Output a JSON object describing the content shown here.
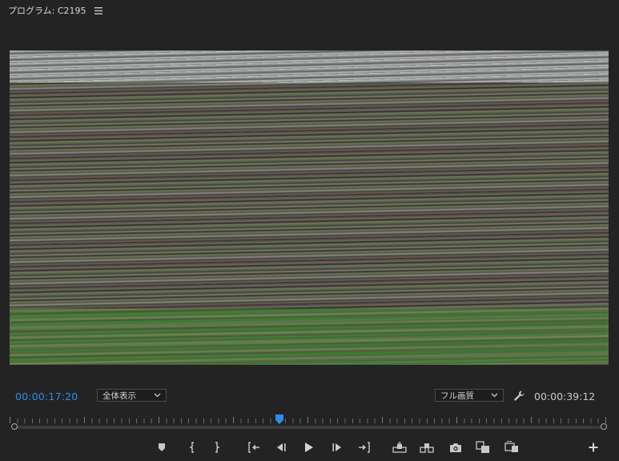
{
  "panel": {
    "title": "プログラム: C2195",
    "menu_icon": "hamburger-menu-icon"
  },
  "timecode": {
    "current": "00:00:17:20",
    "duration": "00:00:39:12"
  },
  "zoom_select": {
    "value": "全体表示"
  },
  "quality_select": {
    "value": "フル画質"
  },
  "timeline": {
    "playhead_fraction": 0.45
  },
  "colors": {
    "accent": "#2d8ceb",
    "panel_bg": "#232323"
  },
  "transport_buttons": [
    {
      "name": "add-marker-button",
      "icon": "marker-icon"
    },
    {
      "name": "mark-in-button",
      "icon": "mark-in-icon"
    },
    {
      "name": "mark-out-button",
      "icon": "mark-out-icon"
    },
    {
      "name": "go-to-in-button",
      "icon": "go-to-in-icon"
    },
    {
      "name": "step-back-button",
      "icon": "step-back-icon"
    },
    {
      "name": "play-button",
      "icon": "play-icon"
    },
    {
      "name": "step-forward-button",
      "icon": "step-forward-icon"
    },
    {
      "name": "go-to-out-button",
      "icon": "go-to-out-icon"
    },
    {
      "name": "lift-button",
      "icon": "lift-icon"
    },
    {
      "name": "extract-button",
      "icon": "extract-icon"
    },
    {
      "name": "export-frame-button",
      "icon": "camera-icon"
    },
    {
      "name": "comparison-view-button",
      "icon": "comparison-view-icon"
    },
    {
      "name": "vr-video-button",
      "icon": "vr-video-icon"
    },
    {
      "name": "button-editor-button",
      "icon": "plus-icon"
    }
  ]
}
